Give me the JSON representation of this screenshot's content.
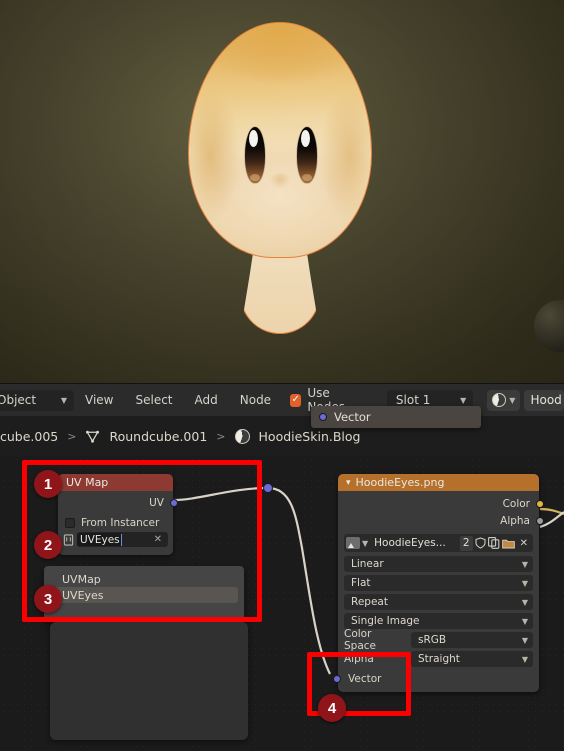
{
  "app": "Blender Shader Editor",
  "viewport": {
    "object_name": "Roundcube head",
    "selected_outline_color": "#e8813b",
    "background_color": "#4a462f"
  },
  "header": {
    "mode_dropdown": "Object",
    "menus": [
      "View",
      "Select",
      "Add",
      "Node"
    ],
    "use_nodes_label": "Use Nodes",
    "use_nodes_checked": true,
    "use_nodes_color": "#e0622a",
    "slot_label": "Slot 1",
    "material_name": "Hood",
    "material_icon": "material-sphere-icon"
  },
  "breadcrumb": {
    "items": [
      "cube.005",
      "Roundcube.001",
      "HoodieSkin.Blog"
    ],
    "separator": ">"
  },
  "tooltip": {
    "label": "Vector",
    "socket_color": "#6b6bd6"
  },
  "nodes": {
    "uv_map": {
      "title": "UV Map",
      "header_color": "#8c3a32",
      "output_socket": "UV",
      "from_instancer_label": "From Instancer",
      "from_instancer_checked": false,
      "field_value": "UVEyes",
      "field_clear_icon": "x-icon"
    },
    "uv_dropdown": {
      "items": [
        {
          "label": "UVMap",
          "selected": false
        },
        {
          "label": "UVEyes",
          "selected": true
        }
      ]
    },
    "image_texture": {
      "title": "HoodieEyes.png",
      "header_color": "#b5702c",
      "outputs": [
        {
          "label": "Color",
          "color": "#e0b641"
        },
        {
          "label": "Alpha",
          "color": "#9b9b9b"
        }
      ],
      "datablock": {
        "browse_icon": "image-browse-icon",
        "name": "HoodieEyes...",
        "users_count": "2",
        "fake_user_icon": "shield-icon",
        "new_icon": "duplicate-icon",
        "open_icon": "folder-icon",
        "unlink_icon": "x-icon"
      },
      "interpolation": "Linear",
      "projection": "Flat",
      "extension": "Repeat",
      "source": "Single Image",
      "color_space_label": "Color Space",
      "color_space_value": "sRGB",
      "alpha_label": "Alpha",
      "alpha_value": "Straight",
      "input_socket": "Vector"
    }
  },
  "annotations": {
    "badges": [
      "1",
      "2",
      "3",
      "4"
    ],
    "box_color": "#fb0000",
    "badge_color": "#90151a"
  }
}
